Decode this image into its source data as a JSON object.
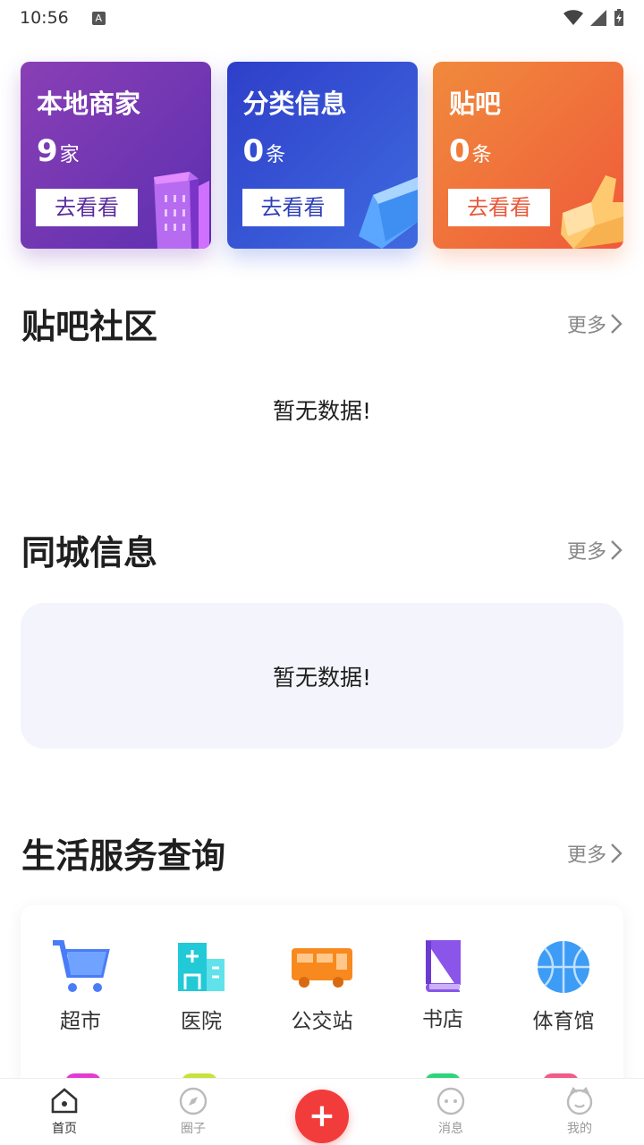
{
  "status_bar": {
    "time": "10:56",
    "notif_icon": "A"
  },
  "cards": [
    {
      "title": "本地商家",
      "count": "9",
      "unit": "家",
      "button": "去看看",
      "icon": "building-icon"
    },
    {
      "title": "分类信息",
      "count": "0",
      "unit": "条",
      "button": "去看看",
      "icon": "cube-icon"
    },
    {
      "title": "贴吧",
      "count": "0",
      "unit": "条",
      "button": "去看看",
      "icon": "thumbs-up-icon"
    }
  ],
  "sections": {
    "tieba": {
      "title": "贴吧社区",
      "more": "更多",
      "empty": "暂无数据!"
    },
    "city": {
      "title": "同城信息",
      "more": "更多",
      "empty": "暂无数据!"
    },
    "life": {
      "title": "生活服务查询",
      "more": "更多"
    }
  },
  "services": [
    {
      "label": "超市",
      "icon": "cart-icon",
      "color": "#4a7cf7"
    },
    {
      "label": "医院",
      "icon": "hospital-icon",
      "color": "#22c9d6"
    },
    {
      "label": "公交站",
      "icon": "bus-icon",
      "color": "#f7891f"
    },
    {
      "label": "书店",
      "icon": "book-icon",
      "color": "#8a55e8"
    },
    {
      "label": "体育馆",
      "icon": "basketball-icon",
      "color": "#3d9cf5"
    }
  ],
  "tabbar": [
    {
      "label": "首页",
      "icon": "home-icon",
      "active": true
    },
    {
      "label": "圈子",
      "icon": "compass-icon",
      "active": false
    },
    {
      "label": "",
      "icon": "plus-icon",
      "active": false
    },
    {
      "label": "消息",
      "icon": "chat-icon",
      "active": false
    },
    {
      "label": "我的",
      "icon": "profile-icon",
      "active": false
    }
  ]
}
